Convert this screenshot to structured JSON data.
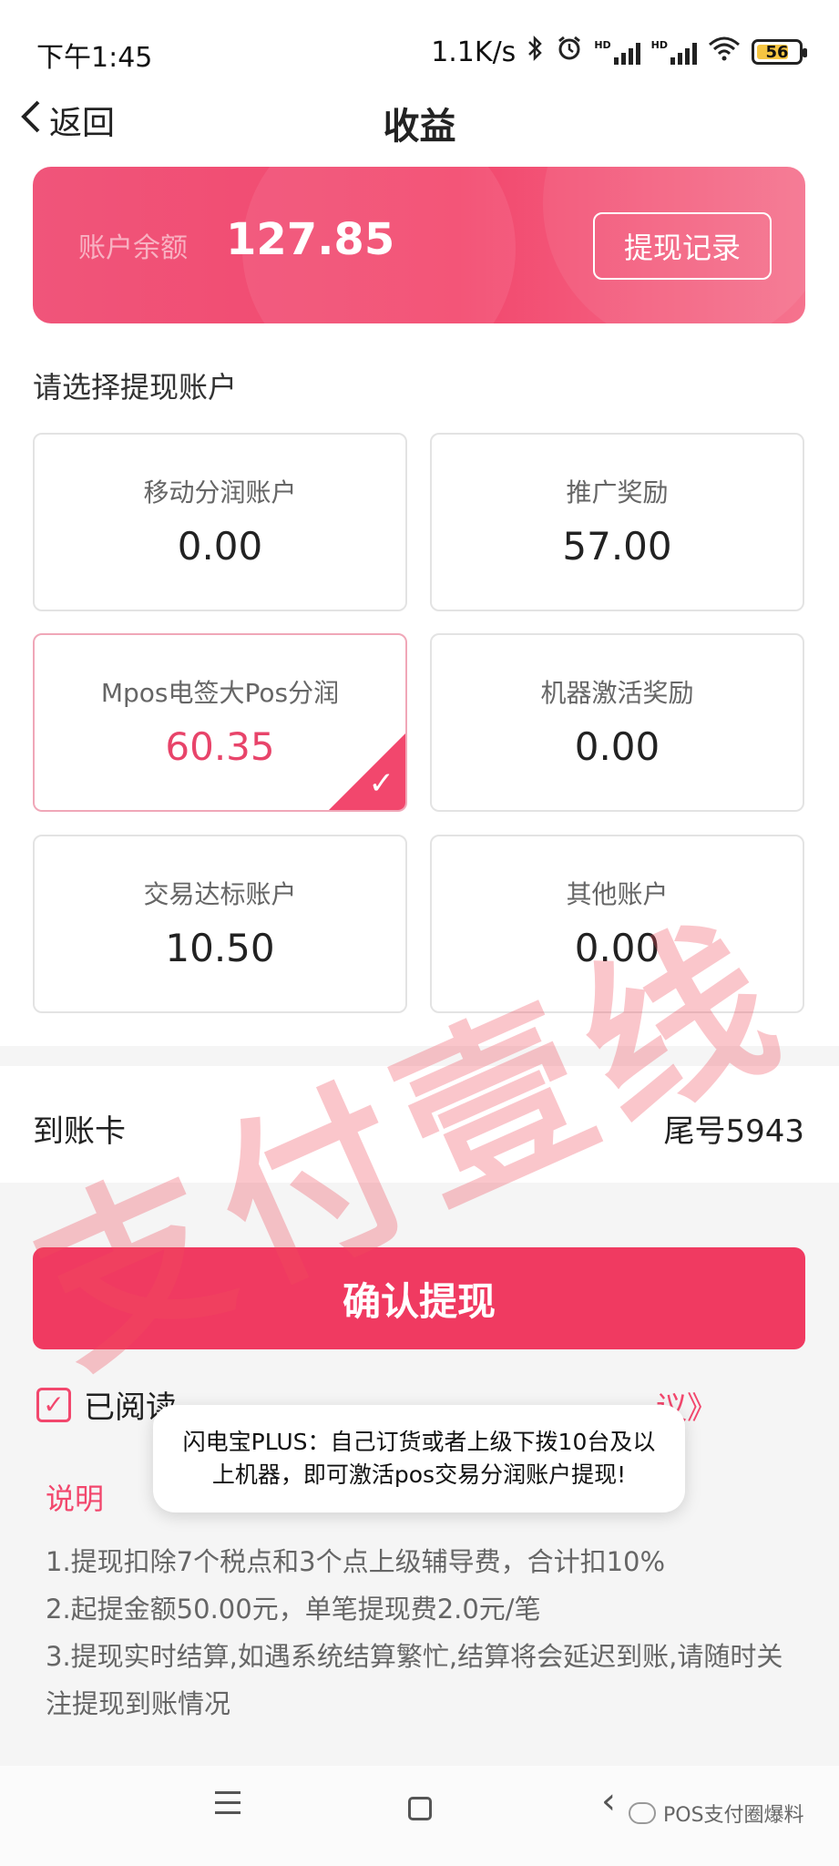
{
  "status_bar": {
    "time": "下午1:45",
    "speed": "1.1K/s",
    "sim1": "HD",
    "sim2": "HD",
    "battery": "56"
  },
  "header": {
    "back_label": "返回",
    "title": "收益"
  },
  "balance": {
    "label": "账户余额",
    "value": "127.85",
    "record_button": "提现记录"
  },
  "section_title": "请选择提现账户",
  "accounts": [
    {
      "name": "移动分润账户",
      "amount": "0.00"
    },
    {
      "name": "推广奖励",
      "amount": "57.00"
    },
    {
      "name": "Mpos电签大Pos分润",
      "amount": "60.35"
    },
    {
      "name": "机器激活奖励",
      "amount": "0.00"
    },
    {
      "name": "交易达标账户",
      "amount": "10.50"
    },
    {
      "name": "其他账户",
      "amount": "0.00"
    }
  ],
  "receive_card": {
    "label": "到账卡",
    "value": "尾号5943"
  },
  "confirm_button": "确认提现",
  "agreement": {
    "prefix": "已阅读",
    "link_suffix": "议》"
  },
  "toast": "闪电宝PLUS：自己订货或者上级下拨10台及以上机器，即可激活pos交易分润账户提现!",
  "notes": {
    "title": "说明",
    "items": [
      "1.提现扣除7个税点和3个点上级辅导费，合计扣10%",
      "2.起提金额50.00元，单笔提现费2.0元/笔",
      "3.提现实时结算,如遇系统结算繁忙,结算将会延迟到账,请随时关注提现到账情况"
    ]
  },
  "watermark": "支付壹线",
  "footer_badge": "POS支付圈爆料",
  "colors": {
    "accent": "#f2476d",
    "button": "#f03a61",
    "background": "#f5f5f5"
  }
}
